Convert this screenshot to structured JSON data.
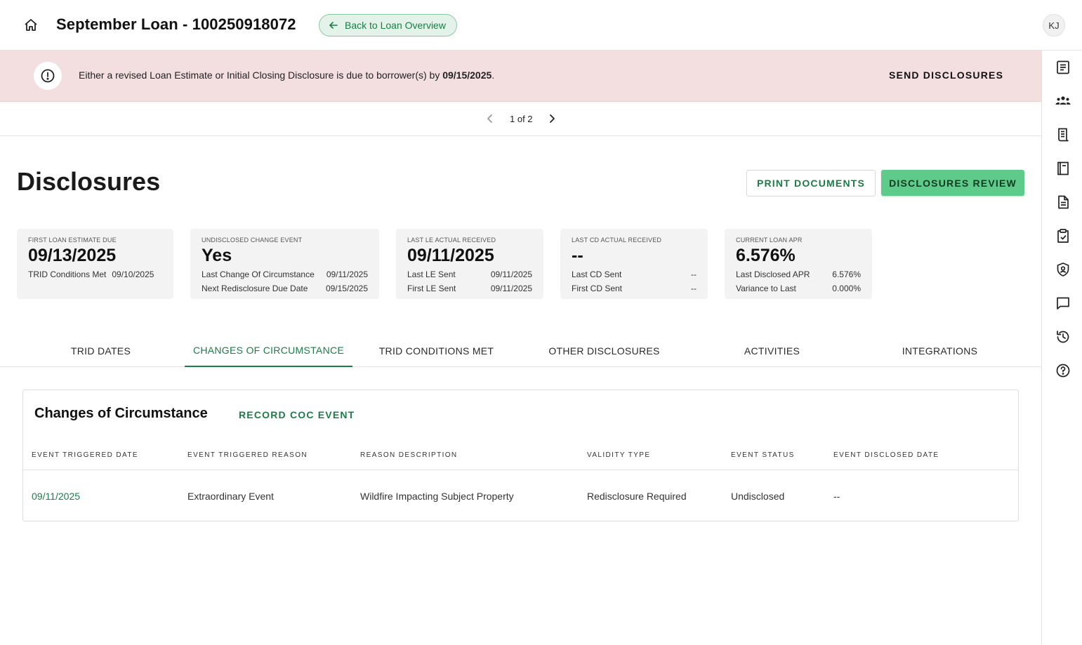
{
  "header": {
    "title": "September Loan - 100250918072",
    "back_label": "Back to Loan Overview",
    "user_initials": "KJ"
  },
  "alert": {
    "text_before": "Either a revised Loan Estimate or Initial Closing Disclosure is due to borrower(s) by ",
    "due_date": "09/15/2025",
    "text_after": ".",
    "action_label": "SEND DISCLOSURES",
    "color": "#f3dfe0"
  },
  "pager": {
    "text": "1 of 2"
  },
  "page": {
    "title": "Disclosures",
    "print_label": "PRINT DOCUMENTS",
    "review_label": "DISCLOSURES REVIEW"
  },
  "cards": [
    {
      "label": "FIRST LOAN ESTIMATE DUE",
      "value": "09/13/2025",
      "rows": [
        {
          "key": "TRID Conditions Met",
          "value": "09/10/2025"
        }
      ]
    },
    {
      "label": "UNDISCLOSED CHANGE EVENT",
      "value": "Yes",
      "rows": [
        {
          "key": "Last Change Of Circumstance",
          "value": "09/11/2025"
        },
        {
          "key": "Next Redisclosure Due Date",
          "value": "09/15/2025"
        }
      ]
    },
    {
      "label": "LAST LE ACTUAL RECEIVED",
      "value": "09/11/2025",
      "rows": [
        {
          "key": "Last LE Sent",
          "value": "09/11/2025"
        },
        {
          "key": "First LE Sent",
          "value": "09/11/2025"
        }
      ]
    },
    {
      "label": "LAST CD ACTUAL RECEIVED",
      "value": "--",
      "rows": [
        {
          "key": "Last CD Sent",
          "value": "--"
        },
        {
          "key": "First CD Sent",
          "value": "--"
        }
      ]
    },
    {
      "label": "CURRENT LOAN APR",
      "value": "6.576%",
      "rows": [
        {
          "key": "Last Disclosed APR",
          "value": "6.576%"
        },
        {
          "key": "Variance to Last",
          "value": "0.000%"
        }
      ]
    }
  ],
  "tabs": [
    {
      "label": "TRID DATES"
    },
    {
      "label": "CHANGES OF CIRCUMSTANCE",
      "active": true
    },
    {
      "label": "TRID CONDITIONS MET"
    },
    {
      "label": "OTHER DISCLOSURES"
    },
    {
      "label": "ACTIVITIES"
    },
    {
      "label": "INTEGRATIONS"
    }
  ],
  "coc": {
    "title": "Changes of Circumstance",
    "record_label": "RECORD COC EVENT",
    "columns": [
      "EVENT TRIGGERED DATE",
      "EVENT TRIGGERED REASON",
      "REASON DESCRIPTION",
      "VALIDITY TYPE",
      "EVENT STATUS",
      "EVENT DISCLOSED DATE"
    ],
    "rows": [
      [
        "09/11/2025",
        "Extraordinary Event",
        "Wildfire Impacting Subject Property",
        "Redisclosure Required",
        "Undisclosed",
        "--"
      ]
    ]
  },
  "rail_icons": [
    "document-list-icon",
    "people-group-icon",
    "receipt-icon",
    "notes-icon",
    "file-text-icon",
    "clipboard-check-icon",
    "shield-user-icon",
    "chat-icon",
    "history-icon",
    "help-icon"
  ],
  "colors": {
    "accent": "#1a7d46",
    "primary_button": "#5fcb8b",
    "card_bg": "#f3f3f3"
  }
}
